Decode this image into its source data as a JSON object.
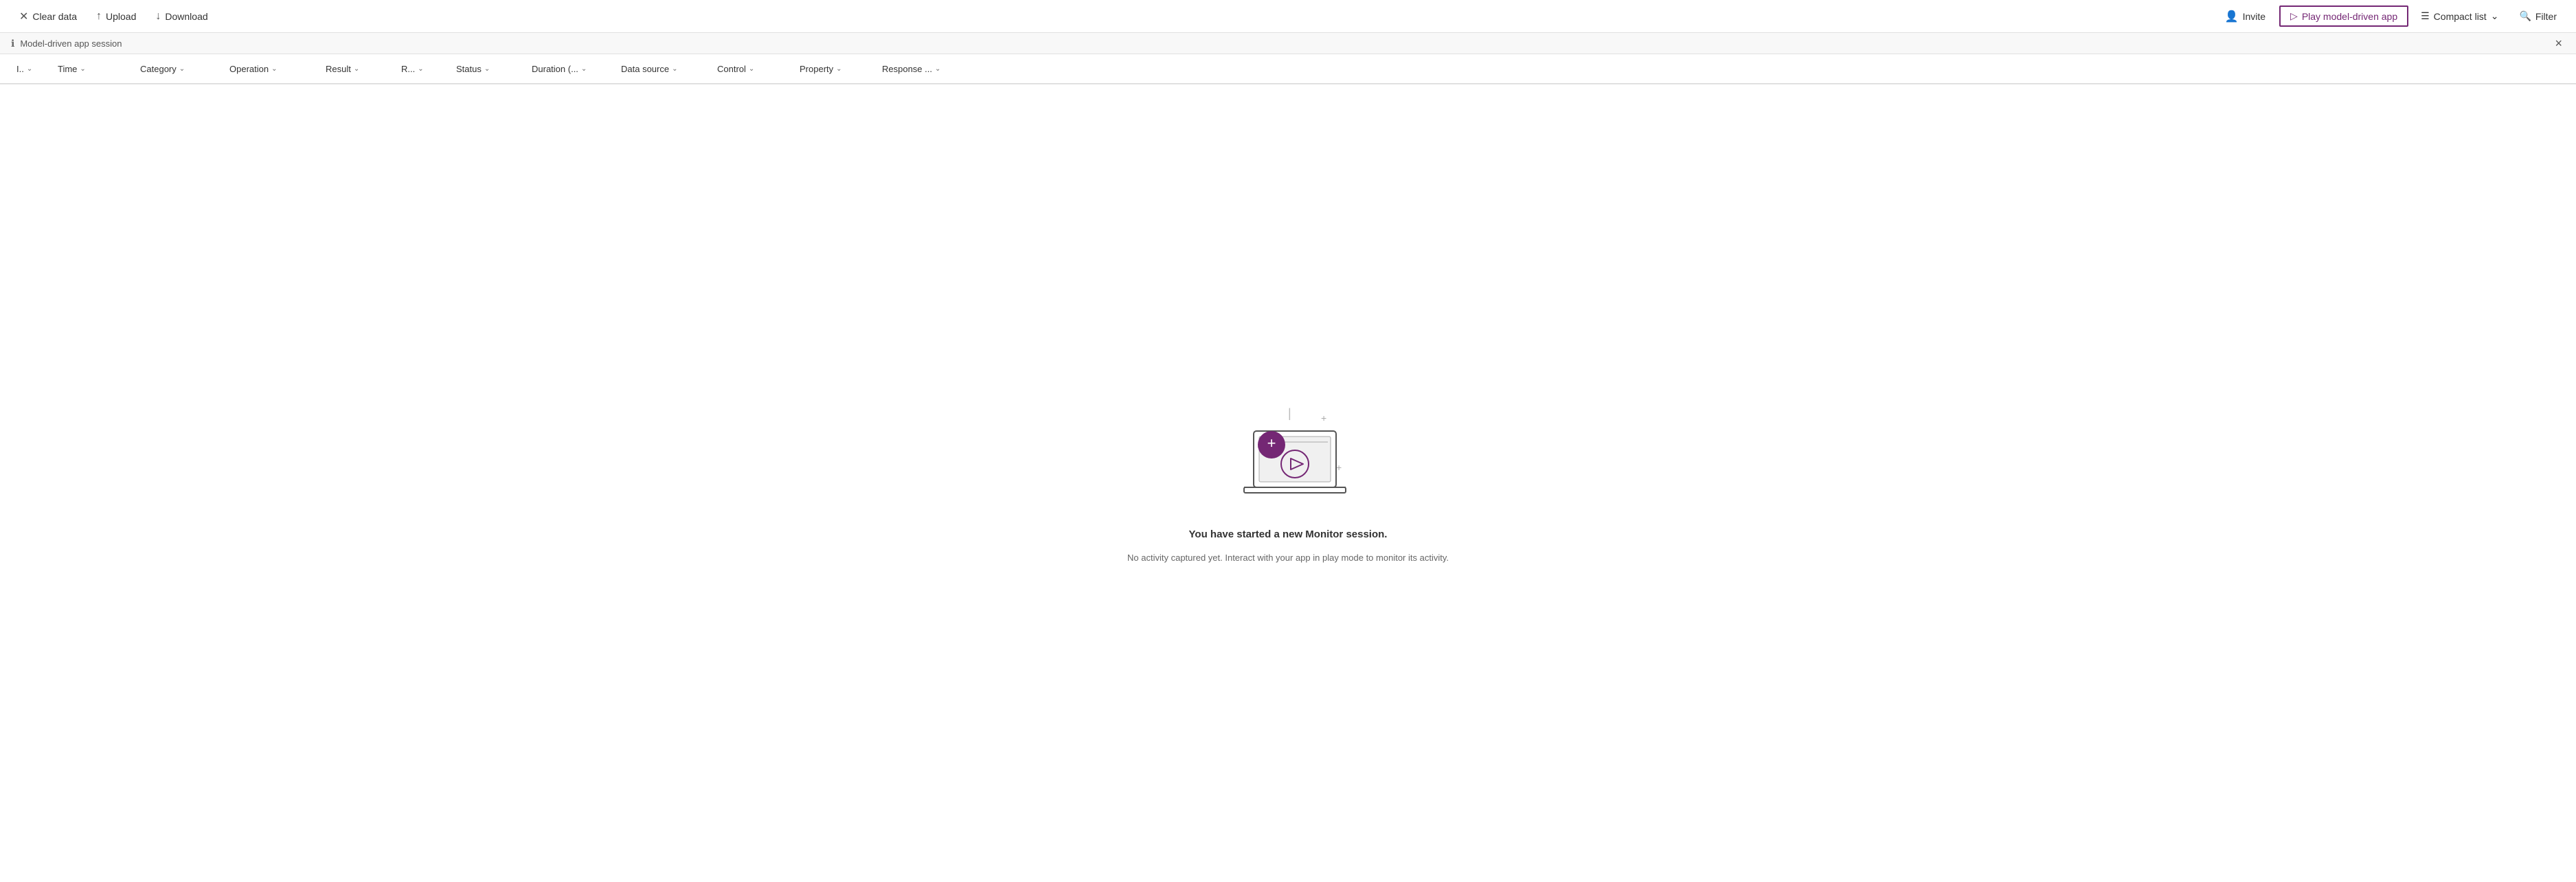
{
  "toolbar": {
    "clear_data_label": "Clear data",
    "upload_label": "Upload",
    "download_label": "Download",
    "invite_label": "Invite",
    "play_model_driven_app_label": "Play model-driven app",
    "compact_list_label": "Compact list",
    "filter_label": "Filter"
  },
  "info_bar": {
    "session_label": "Model-driven app session"
  },
  "columns": [
    {
      "id": "col-id",
      "label": "I..",
      "short": true
    },
    {
      "id": "col-time",
      "label": "Time"
    },
    {
      "id": "col-category",
      "label": "Category"
    },
    {
      "id": "col-operation",
      "label": "Operation"
    },
    {
      "id": "col-result",
      "label": "Result"
    },
    {
      "id": "col-r",
      "label": "R..."
    },
    {
      "id": "col-status",
      "label": "Status"
    },
    {
      "id": "col-duration",
      "label": "Duration (..."
    },
    {
      "id": "col-datasource",
      "label": "Data source"
    },
    {
      "id": "col-control",
      "label": "Control"
    },
    {
      "id": "col-property",
      "label": "Property"
    },
    {
      "id": "col-response",
      "label": "Response ..."
    }
  ],
  "empty_state": {
    "title": "You have started a new Monitor session.",
    "subtitle": "No activity captured yet. Interact with your app in play mode to monitor its activity.",
    "illustration_alt": "Monitor session laptop illustration"
  },
  "colors": {
    "accent": "#742774",
    "border": "#e0e0e0",
    "text_primary": "#333333",
    "text_secondary": "#666666"
  }
}
